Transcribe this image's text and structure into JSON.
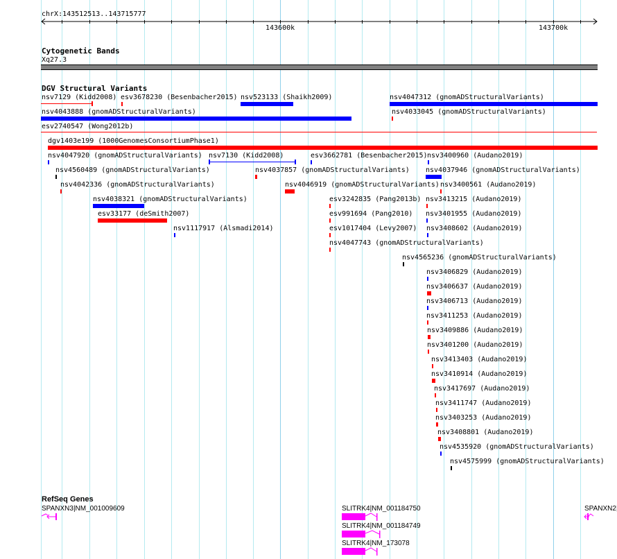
{
  "ruler": {
    "location": "chrX:143512513..143715777",
    "major_labels": [
      "143600k",
      "143700k"
    ]
  },
  "tracks": {
    "cytoband": {
      "title": "Cytogenetic Bands",
      "band_label": "Xq27.3",
      "band_color": "#808080"
    },
    "dgv": {
      "title": "DGV Structural Variants",
      "colors": {
        "gain": "#0000ff",
        "loss": "#ff0000",
        "other": "#000000"
      },
      "features": [
        "nsv7129 (Kidd2008)",
        "esv3678230 (Besenbacher2015)",
        "nsv523133 (Shaikh2009)",
        "nsv4047312 (gnomADStructuralVariants)",
        "nsv4043888 (gnomADStructuralVariants)",
        "nsv4033045 (gnomADStructuralVariants)",
        "esv2740547 (Wong2012b)",
        "dgv1403e199 (1000GenomesConsortiumPhase1)",
        "nsv4047920 (gnomADStructuralVariants)",
        "nsv7130 (Kidd2008)",
        "esv3662781 (Besenbacher2015)",
        "nsv3400960 (Audano2019)",
        "nsv4560489 (gnomADStructuralVariants)",
        "nsv4037857 (gnomADStructuralVariants)",
        "nsv4037946 (gnomADStructuralVariants)",
        "nsv4042336 (gnomADStructuralVariants)",
        "nsv4046919 (gnomADStructuralVariants)",
        "nsv3400561 (Audano2019)",
        "nsv4038321 (gnomADStructuralVariants)",
        "esv3242835 (Pang2013b)",
        "nsv3413215 (Audano2019)",
        "esv33177 (deSmith2007)",
        "esv991694 (Pang2010)",
        "nsv3401955 (Audano2019)",
        "nsv1117917 (Alsmadi2014)",
        "esv1017404 (Levy2007)",
        "nsv3408602 (Audano2019)",
        "nsv4047743 (gnomADStructuralVariants)",
        "nsv4565236 (gnomADStructuralVariants)",
        "nsv3406829 (Audano2019)",
        "nsv3406637 (Audano2019)",
        "nsv3406713 (Audano2019)",
        "nsv3411253 (Audano2019)",
        "nsv3409886 (Audano2019)",
        "nsv3401200 (Audano2019)",
        "nsv3413403 (Audano2019)",
        "nsv3410914 (Audano2019)",
        "nsv3417697 (Audano2019)",
        "nsv3411747 (Audano2019)",
        "nsv3403253 (Audano2019)",
        "nsv3408801 (Audano2019)",
        "nsv4535920 (gnomADStructuralVariants)",
        "nsv4575999 (gnomADStructuralVariants)"
      ]
    },
    "refseq": {
      "title": "RefSeq Genes",
      "color": "#ff00ff",
      "genes": [
        "SPANXN3|NM_001009609",
        "SLITRK4|NM_001184750",
        "SLITRK4|NM_001184749",
        "SLITRK4|NM_173078",
        "SPANXN2|"
      ]
    }
  }
}
